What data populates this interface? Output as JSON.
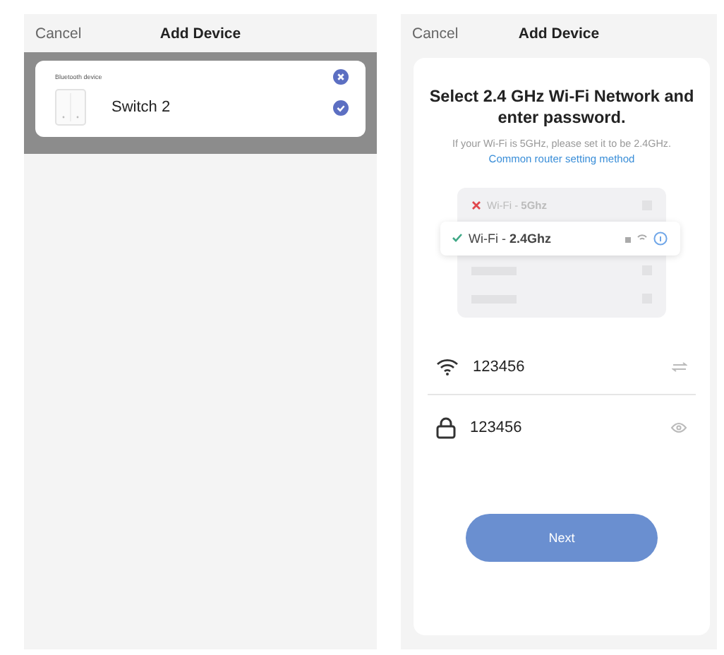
{
  "left_screen": {
    "header": {
      "cancel": "Cancel",
      "title": "Add Device"
    },
    "device_card": {
      "caption": "Bluetooth device",
      "devices": [
        {
          "name": "Switch 2",
          "selected": true
        }
      ]
    }
  },
  "right_screen": {
    "header": {
      "cancel": "Cancel",
      "title": "Add Device"
    },
    "heading": "Select 2.4 GHz Wi-Fi Network and enter password.",
    "hint": "If your Wi-Fi is 5GHz, please set it to be 2.4GHz.",
    "link": "Common router setting method",
    "networks": [
      {
        "label": "Wi-Fi - **5Ghz**",
        "selected": false
      },
      {
        "label": "Wi-Fi - **2.4Ghz**",
        "selected": true
      }
    ],
    "fields": [
      {
        "kind": "wifi",
        "value": "123456"
      },
      {
        "kind": "password",
        "value": "123456"
      }
    ],
    "button": "Next"
  }
}
